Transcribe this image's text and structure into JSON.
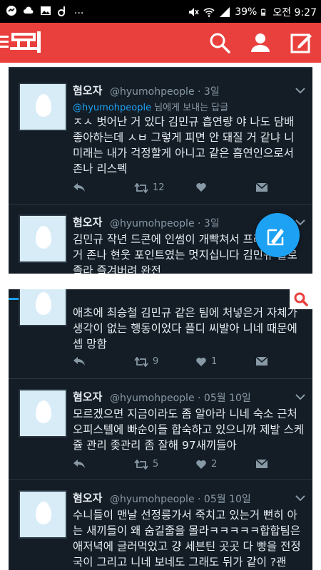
{
  "status_bar": {
    "dots": "...",
    "battery": "39%",
    "time": "오전 9:27"
  },
  "appbar": {
    "logo_text": "판"
  },
  "tweets_top": [
    {
      "name": "혐오자",
      "handle": "@hyumohpeople · 3일",
      "reply_mention": "@hyumohpeople",
      "reply_suffix": " 님에게 보내는 답글",
      "text": "ㅈㅅ 벗어난 거 있다 김민규 흡연량 야 나도 담배 좋아하는데 ㅅㅂ 그렇게 피면 안 돼질 거 같냐 니 미래는 내가 걱정할게 아니고 같은 흡연인으로서 존나 리스펙",
      "retweets": "12",
      "likes": ""
    },
    {
      "name": "혐오자",
      "handle": "@hyumohpeople · 3일",
      "text": "김민규 작년 드콘에 인썸이 개빡쳐서 프리뷰 올린 거 존나 현웃 포인트였는 멋지십니다 김민규 율로 졸라 즐겨버려 완전"
    }
  ],
  "tweets_bottom": [
    {
      "text": "애초에 최승철 김민규 같은 팀에 처넣은거 자체가 생각이 없는 행동이었다 플디 씨발아 니네 때문에 셉 망함",
      "retweets": "9",
      "likes": "1"
    },
    {
      "name": "혐오자",
      "handle": "@hyumohpeople · 05월 10일",
      "text": "모르겠으면 지금이라도 좀 알아라 니네 숙소 근처 오피스텔에 빠순이들 합숙하고 있으니까 제발 스케쥴 관리 좆관리 좀 잘해 97새끼들아",
      "retweets": "5",
      "likes": "2"
    },
    {
      "name": "혐오자",
      "handle": "@hyumohpeople · 05월 10일",
      "text": "수니들이 맨날 선정릉가서 죽치고 있는거 뻔히 아는 새끼들이 왜 숨길줄을 몰라ㅋㅋㅋㅋㅋ합합팀은 애저녁에 글러먹었고 걍 세븐틴 곳곳 다 빵을 전정국이 그리고 니네 보네도 그래도 뒤가 같이 ?괜"
    }
  ],
  "colors": {
    "appbar": "#e9403e",
    "tweet_bg": "#141d26",
    "accent": "#1da1f2"
  }
}
